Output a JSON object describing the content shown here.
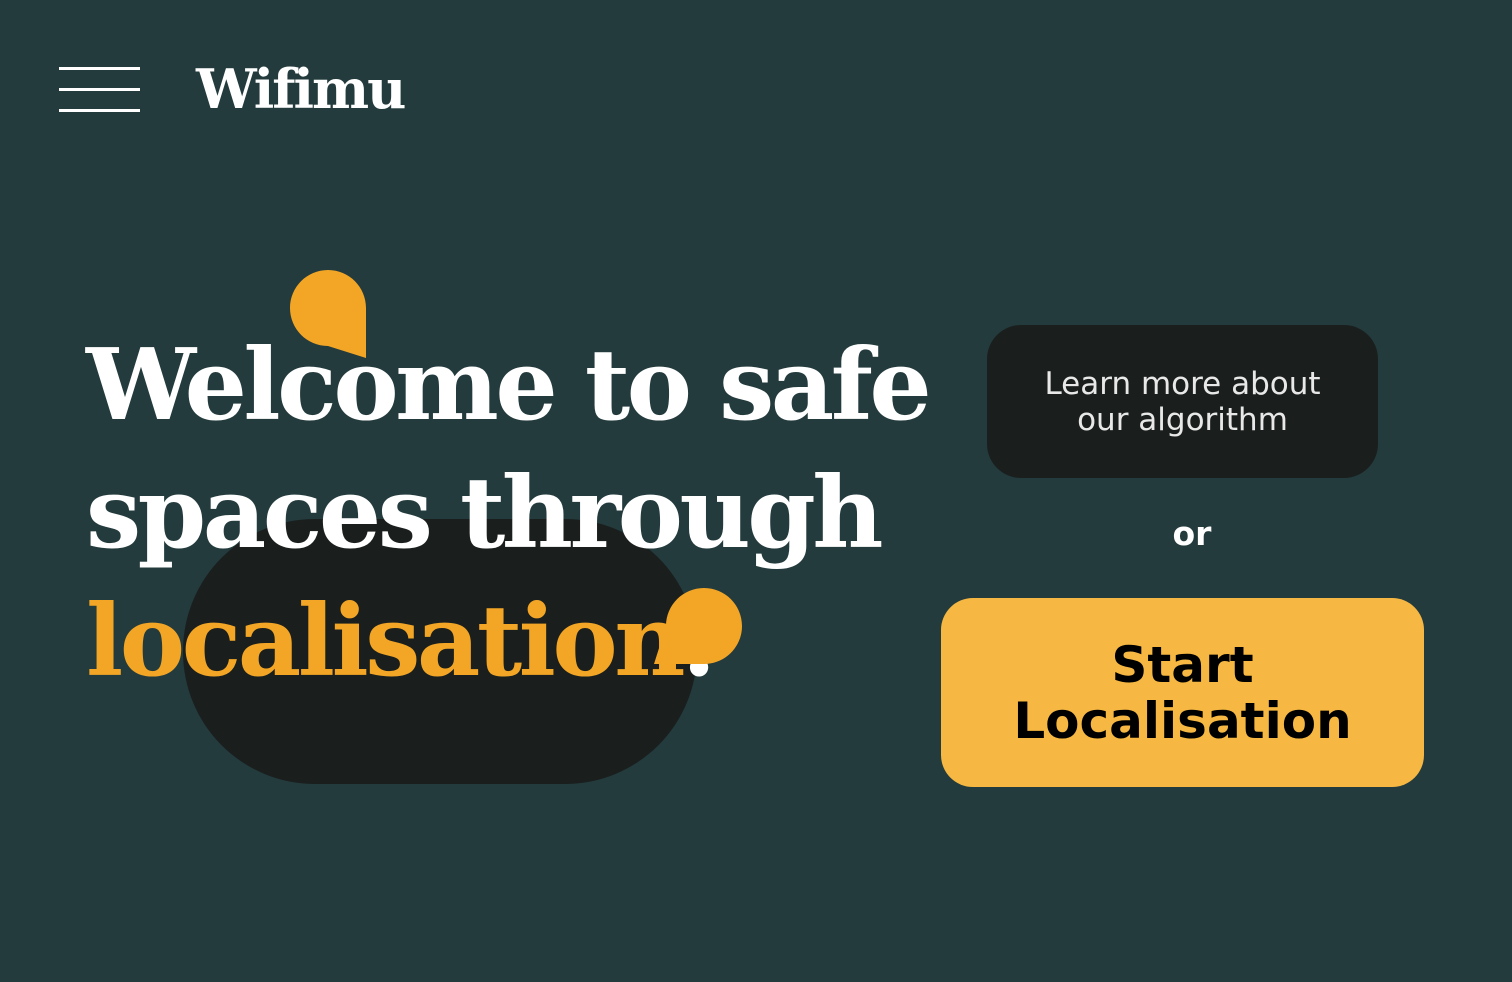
{
  "colors": {
    "background": "#243b3d",
    "dark": "#1a1f1e",
    "accent": "#f3a626",
    "button_yellow": "#f6b842",
    "text_light": "#ffffff",
    "text_muted": "#e8e8e8",
    "text_dark": "#000000"
  },
  "header": {
    "menu_icon": "hamburger-menu-icon",
    "brand": "Wifimu"
  },
  "hero": {
    "line1": "Welcome to safe",
    "line2": "spaces through",
    "highlight": "localisation",
    "period": "."
  },
  "actions": {
    "learn_more_line1": "Learn more about",
    "learn_more_line2": "our algorithm",
    "or": "or",
    "start_line1": "Start",
    "start_line2": "Localisation"
  },
  "decor": {
    "shape_1": "location-drop-icon",
    "shape_2": "location-drop-icon"
  }
}
